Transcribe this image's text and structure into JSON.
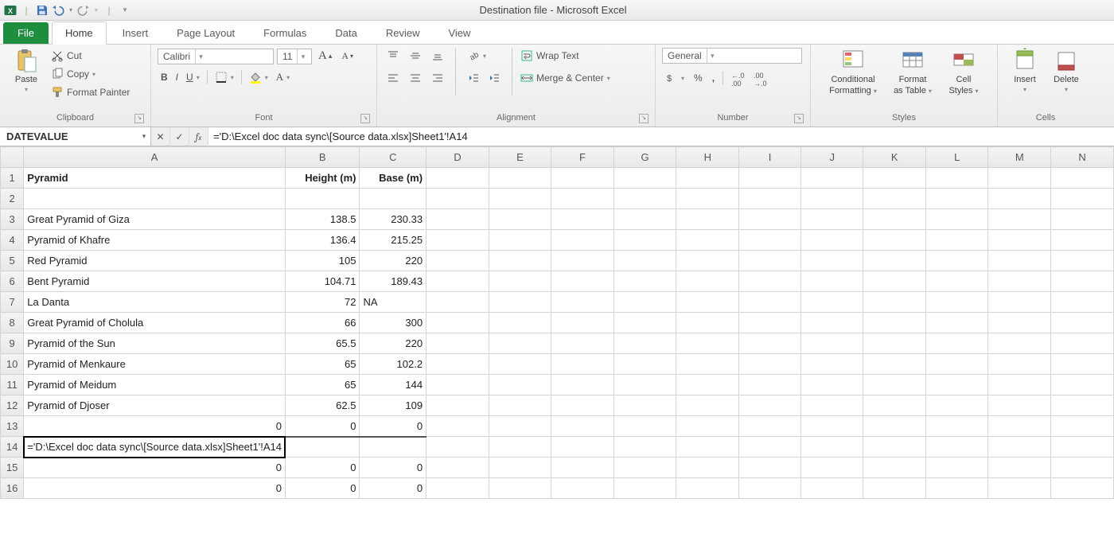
{
  "title": "Destination file  -  Microsoft Excel",
  "qat": {
    "save": "save",
    "undo": "undo",
    "redo": "redo"
  },
  "tabs": {
    "file": "File",
    "items": [
      "Home",
      "Insert",
      "Page Layout",
      "Formulas",
      "Data",
      "Review",
      "View"
    ],
    "active": "Home"
  },
  "ribbon": {
    "clipboard": {
      "label": "Clipboard",
      "paste": "Paste",
      "cut": "Cut",
      "copy": "Copy",
      "fmtpainter": "Format Painter"
    },
    "font": {
      "label": "Font",
      "name": "Calibri",
      "size": "11",
      "bold": "B",
      "italic": "I",
      "underline": "U"
    },
    "alignment": {
      "label": "Alignment",
      "wrap": "Wrap Text",
      "merge": "Merge & Center"
    },
    "number": {
      "label": "Number",
      "format": "General"
    },
    "styles": {
      "label": "Styles",
      "cond": "Conditional",
      "cond2": "Formatting",
      "fat": "Format",
      "fat2": "as Table",
      "cell": "Cell",
      "cell2": "Styles"
    },
    "cells": {
      "label": "Cells",
      "insert": "Insert",
      "delete": "Delete"
    }
  },
  "namebox": "DATEVALUE",
  "formula": "='D:\\Excel doc data sync\\[Source data.xlsx]Sheet1'!A14",
  "columns": [
    "A",
    "B",
    "C",
    "D",
    "E",
    "F",
    "G",
    "H",
    "I",
    "J",
    "K",
    "L",
    "M",
    "N"
  ],
  "headers": {
    "A": "Pyramid",
    "B": "Height (m)",
    "C": "Base (m)"
  },
  "rows": [
    {
      "r": 1,
      "A": "Pyramid",
      "B": "Height (m)",
      "C": "Base (m)",
      "bold": true
    },
    {
      "r": 2,
      "A": "",
      "B": "",
      "C": ""
    },
    {
      "r": 3,
      "A": "Great Pyramid of Giza",
      "B": "138.5",
      "C": "230.33"
    },
    {
      "r": 4,
      "A": "Pyramid of Khafre",
      "B": "136.4",
      "C": "215.25"
    },
    {
      "r": 5,
      "A": "Red Pyramid",
      "B": "105",
      "C": "220"
    },
    {
      "r": 6,
      "A": "Bent Pyramid",
      "B": "104.71",
      "C": "189.43"
    },
    {
      "r": 7,
      "A": "La Danta",
      "B": "72",
      "C": "NA",
      "Ctxt": true
    },
    {
      "r": 8,
      "A": "Great Pyramid of Cholula",
      "B": "66",
      "C": "300"
    },
    {
      "r": 9,
      "A": "Pyramid of the Sun",
      "B": "65.5",
      "C": "220"
    },
    {
      "r": 10,
      "A": "Pyramid of Menkaure",
      "B": "65",
      "C": "102.2"
    },
    {
      "r": 11,
      "A": "Pyramid of Meidum",
      "B": "65",
      "C": "144"
    },
    {
      "r": 12,
      "A": "Pyramid of Djoser",
      "B": "62.5",
      "C": "109"
    },
    {
      "r": 13,
      "A": "0",
      "B": "0",
      "C": "0",
      "Anum": true
    },
    {
      "r": 14,
      "A": "='D:\\Excel doc data sync\\[Source data.xlsx]Sheet1'!A14",
      "B": "",
      "C": "",
      "editing": true,
      "overflow": true
    },
    {
      "r": 15,
      "A": "0",
      "B": "0",
      "C": "0",
      "Anum": true
    },
    {
      "r": 16,
      "A": "0",
      "B": "0",
      "C": "0",
      "Anum": true
    }
  ],
  "chart_data": {
    "type": "table",
    "title": "Pyramid heights and bases",
    "columns": [
      "Pyramid",
      "Height (m)",
      "Base (m)"
    ],
    "rows": [
      [
        "Great Pyramid of Giza",
        138.5,
        230.33
      ],
      [
        "Pyramid of Khafre",
        136.4,
        215.25
      ],
      [
        "Red Pyramid",
        105,
        220
      ],
      [
        "Bent Pyramid",
        104.71,
        189.43
      ],
      [
        "La Danta",
        72,
        "NA"
      ],
      [
        "Great Pyramid of Cholula",
        66,
        300
      ],
      [
        "Pyramid of the Sun",
        65.5,
        220
      ],
      [
        "Pyramid of Menkaure",
        65,
        102.2
      ],
      [
        "Pyramid of Meidum",
        65,
        144
      ],
      [
        "Pyramid of Djoser",
        62.5,
        109
      ]
    ]
  }
}
